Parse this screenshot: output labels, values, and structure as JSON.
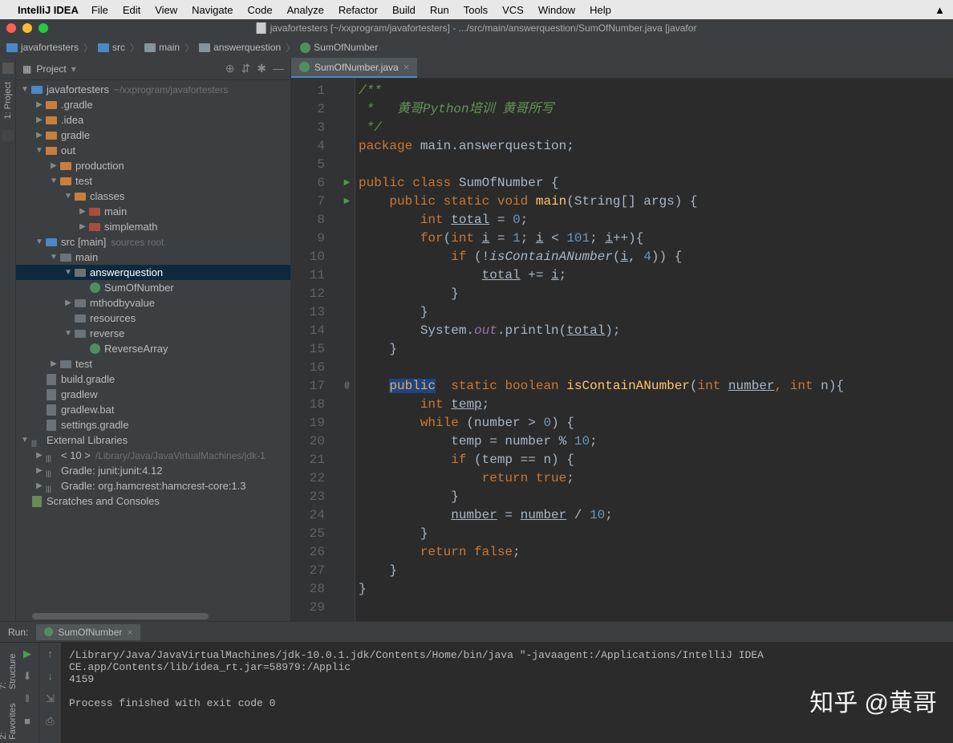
{
  "menubar": {
    "app": "IntelliJ IDEA",
    "items": [
      "File",
      "Edit",
      "View",
      "Navigate",
      "Code",
      "Analyze",
      "Refactor",
      "Build",
      "Run",
      "Tools",
      "VCS",
      "Window",
      "Help"
    ]
  },
  "window_title": "javafortesters [~/xxprogram/javafortesters] - .../src/main/answerquestion/SumOfNumber.java [javafor",
  "breadcrumbs": [
    "javafortesters",
    "src",
    "main",
    "answerquestion",
    "SumOfNumber"
  ],
  "project_panel": {
    "title": "Project"
  },
  "tree": {
    "root": "javafortesters",
    "root_path": "~/xxprogram/javafortesters",
    "nodes": [
      {
        "d": 1,
        "a": "r",
        "t": "folder",
        "c": "orange",
        "l": ".gradle"
      },
      {
        "d": 1,
        "a": "r",
        "t": "folder",
        "c": "orange",
        "l": ".idea"
      },
      {
        "d": 1,
        "a": "r",
        "t": "folder",
        "c": "orange",
        "l": "gradle"
      },
      {
        "d": 1,
        "a": "d",
        "t": "folder",
        "c": "orange",
        "l": "out"
      },
      {
        "d": 2,
        "a": "r",
        "t": "folder",
        "c": "orange",
        "l": "production"
      },
      {
        "d": 2,
        "a": "d",
        "t": "folder",
        "c": "orange",
        "l": "test"
      },
      {
        "d": 3,
        "a": "d",
        "t": "folder",
        "c": "orange",
        "l": "classes"
      },
      {
        "d": 4,
        "a": "r",
        "t": "folder",
        "c": "red",
        "l": "main"
      },
      {
        "d": 4,
        "a": "r",
        "t": "folder",
        "c": "red",
        "l": "simplemath"
      },
      {
        "d": 1,
        "a": "d",
        "t": "folder",
        "c": "blue",
        "l": "src [main]",
        "dim": "sources root"
      },
      {
        "d": 2,
        "a": "d",
        "t": "folder",
        "c": "gray",
        "l": "main"
      },
      {
        "d": 3,
        "a": "d",
        "t": "folder",
        "c": "gray",
        "l": "answerquestion",
        "sel": true
      },
      {
        "d": 4,
        "a": "",
        "t": "class",
        "c": "",
        "l": "SumOfNumber"
      },
      {
        "d": 3,
        "a": "r",
        "t": "folder",
        "c": "gray",
        "l": "mthodbyvalue"
      },
      {
        "d": 3,
        "a": "",
        "t": "folder",
        "c": "gray",
        "l": "resources"
      },
      {
        "d": 3,
        "a": "d",
        "t": "folder",
        "c": "gray",
        "l": "reverse"
      },
      {
        "d": 4,
        "a": "",
        "t": "class",
        "c": "",
        "l": "ReverseArray"
      },
      {
        "d": 2,
        "a": "r",
        "t": "folder",
        "c": "gray",
        "l": "test"
      },
      {
        "d": 1,
        "a": "",
        "t": "file",
        "c": "",
        "l": "build.gradle"
      },
      {
        "d": 1,
        "a": "",
        "t": "file",
        "c": "",
        "l": "gradlew"
      },
      {
        "d": 1,
        "a": "",
        "t": "file",
        "c": "",
        "l": "gradlew.bat"
      },
      {
        "d": 1,
        "a": "",
        "t": "file",
        "c": "",
        "l": "settings.gradle"
      }
    ],
    "ext_lib": "External Libraries",
    "ext_items": [
      {
        "l": "< 10 >",
        "dim": "/Library/Java/JavaVirtualMachines/jdk-1"
      },
      {
        "l": "Gradle: junit:junit:4.12"
      },
      {
        "l": "Gradle: org.hamcrest:hamcrest-core:1.3"
      }
    ],
    "scratches": "Scratches and Consoles"
  },
  "editor": {
    "tab": "SumOfNumber.java",
    "lines": [
      1,
      2,
      3,
      4,
      5,
      6,
      7,
      8,
      9,
      10,
      11,
      12,
      13,
      14,
      15,
      16,
      17,
      18,
      19,
      20,
      21,
      22,
      23,
      24,
      25,
      26,
      27,
      28,
      29
    ]
  },
  "code": {
    "l1": "/**",
    "l2a": " *   ",
    "l2b": "黄哥Python培训 黄哥所写",
    "l3": " */",
    "l4a": "package",
    "l4b": " main.answerquestion;",
    "l6a": "public",
    "l6b": " ",
    "l6c": "class",
    "l6d": " SumOfNumber {",
    "l7a": "    ",
    "l7b": "public",
    "l7c": " ",
    "l7d": "static",
    "l7e": " ",
    "l7f": "void",
    "l7g": " ",
    "l7h": "main",
    "l7i": "(String[] args) {",
    "l8a": "        ",
    "l8b": "int",
    "l8c": " ",
    "l8d": "total",
    "l8e": " = ",
    "l8f": "0",
    "l8g": ";",
    "l9a": "        ",
    "l9b": "for",
    "l9c": "(",
    "l9d": "int",
    "l9e": " ",
    "l9f": "i",
    "l9g": " = ",
    "l9h": "1",
    "l9i": "; ",
    "l9j": "i",
    "l9k": " < ",
    "l9l": "101",
    "l9m": "; ",
    "l9n": "i",
    "l9o": "++){",
    "l10a": "            ",
    "l10b": "if",
    "l10c": " (!",
    "l10d": "isContainANumber",
    "l10e": "(",
    "l10f": "i",
    "l10g": ", ",
    "l10h": "4",
    "l10i": ")) {",
    "l11a": "                ",
    "l11b": "total",
    "l11c": " += ",
    "l11d": "i",
    "l11e": ";",
    "l12": "            }",
    "l13": "        }",
    "l14a": "        System.",
    "l14b": "out",
    "l14c": ".println(",
    "l14d": "total",
    "l14e": ");",
    "l15": "    }",
    "l17a": "    ",
    "l17b": "public",
    "l17c": "  ",
    "l17d": "static",
    "l17e": " ",
    "l17f": "boolean",
    "l17g": " ",
    "l17h": "isContainANumber",
    "l17i": "(",
    "l17j": "int",
    "l17k": " ",
    "l17l": "number",
    "l17m": ", ",
    "l17n": "int",
    "l17o": " n){",
    "l18a": "        ",
    "l18b": "int",
    "l18c": " ",
    "l18d": "temp",
    "l18e": ";",
    "l19a": "        ",
    "l19b": "while",
    "l19c": " (number > ",
    "l19d": "0",
    "l19e": ") {",
    "l20a": "            temp = number % ",
    "l20b": "10",
    "l20c": ";",
    "l21a": "            ",
    "l21b": "if",
    "l21c": " (temp == n) {",
    "l22a": "                ",
    "l22b": "return",
    "l22c": " ",
    "l22d": "true",
    "l22e": ";",
    "l23": "            }",
    "l24a": "            ",
    "l24b": "number",
    "l24c": " = ",
    "l24d": "number",
    "l24e": " / ",
    "l24f": "10",
    "l24g": ";",
    "l25": "        }",
    "l26a": "        ",
    "l26b": "return",
    "l26c": " ",
    "l26d": "false",
    "l26e": ";",
    "l27": "    }",
    "l28": "}"
  },
  "run": {
    "label": "Run:",
    "tab": "SumOfNumber",
    "output_line1": "/Library/Java/JavaVirtualMachines/jdk-10.0.1.jdk/Contents/Home/bin/java \"-javaagent:/Applications/IntelliJ IDEA CE.app/Contents/lib/idea_rt.jar=58979:/Applic",
    "output_line2": "4159",
    "output_line3": "",
    "output_line4": "Process finished with exit code 0"
  },
  "left_tabs": {
    "project": "1: Project",
    "structure": "7: Structure",
    "fav": "2: Favorites"
  },
  "watermark": "知乎 @黄哥"
}
